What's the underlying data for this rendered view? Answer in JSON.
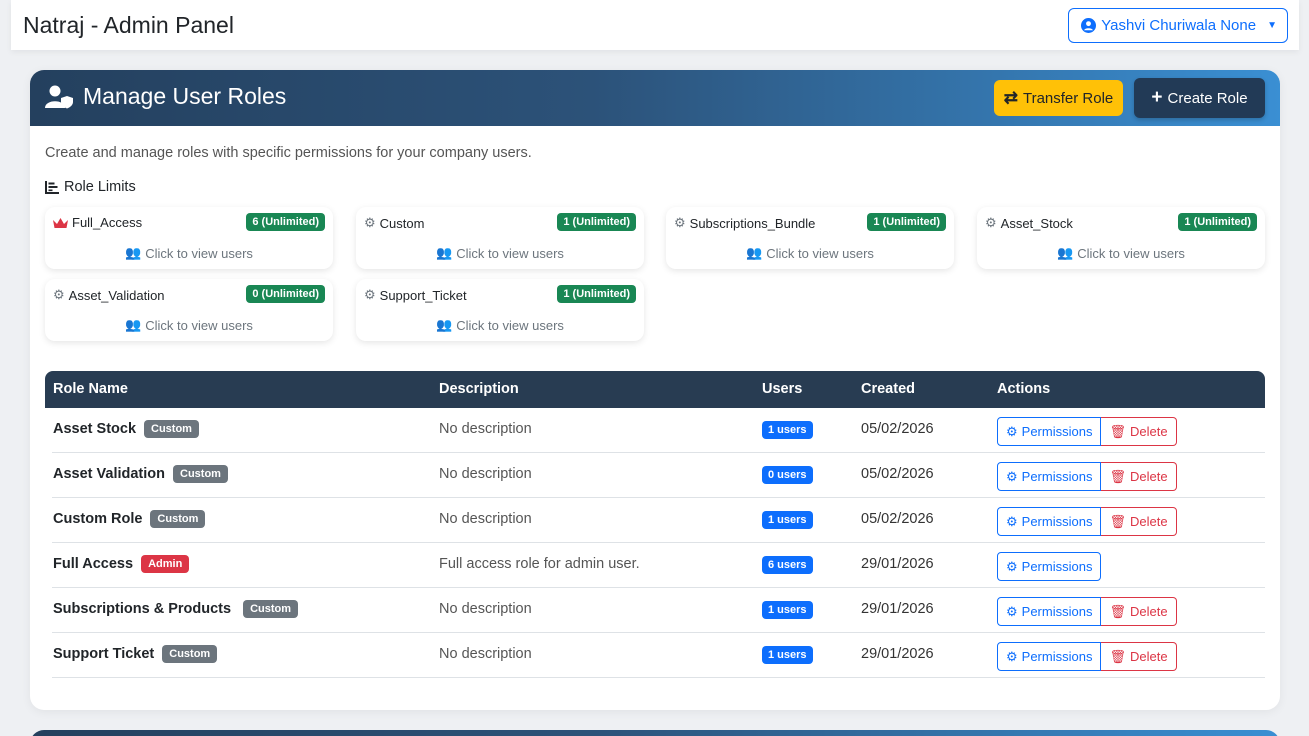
{
  "app": {
    "title": "Natraj - Admin Panel",
    "user_menu": "Yashvi Churiwala None"
  },
  "header": {
    "title": "Manage User Roles",
    "transfer_label": "Transfer Role",
    "create_label": "Create Role"
  },
  "subtitle": "Create and manage roles with specific permissions for your company users.",
  "limits_title": "Role Limits",
  "view_users_label": "Click to view users",
  "role_limits": [
    {
      "name": "Full_Access",
      "badge": "6 (Unlimited)",
      "icon": "crown-icon"
    },
    {
      "name": "Custom",
      "badge": "1 (Unlimited)",
      "icon": "gears-icon"
    },
    {
      "name": "Subscriptions_Bundle",
      "badge": "1 (Unlimited)",
      "icon": "gears-icon"
    },
    {
      "name": "Asset_Stock",
      "badge": "1 (Unlimited)",
      "icon": "gears-icon"
    },
    {
      "name": "Asset_Validation",
      "badge": "0 (Unlimited)",
      "icon": "gears-icon"
    },
    {
      "name": "Support_Ticket",
      "badge": "1 (Unlimited)",
      "icon": "gears-icon"
    }
  ],
  "table": {
    "headers": [
      "Role Name",
      "Description",
      "Users",
      "Created",
      "Actions"
    ],
    "permissions_label": "Permissions",
    "delete_label": "Delete",
    "rows": [
      {
        "name": "Asset Stock",
        "type": "Custom",
        "description": "No description",
        "users": "1 users",
        "created": "05/02/2026"
      },
      {
        "name": "Asset Validation",
        "type": "Custom",
        "description": "No description",
        "users": "0 users",
        "created": "05/02/2026"
      },
      {
        "name": "Custom Role",
        "type": "Custom",
        "description": "No description",
        "users": "1 users",
        "created": "05/02/2026"
      },
      {
        "name": "Full Access",
        "type": "Admin",
        "description": "Full access role for admin user.",
        "users": "6 users",
        "created": "29/01/2026"
      },
      {
        "name": "Subscriptions & Products",
        "type": "Custom",
        "description": "No description",
        "users": "1 users",
        "created": "29/01/2026"
      },
      {
        "name": "Support Ticket",
        "type": "Custom",
        "description": "No description",
        "users": "1 users",
        "created": "29/01/2026"
      }
    ]
  },
  "colors": {
    "primary": "#0d6efd",
    "danger": "#dc3545",
    "warning": "#ffc107",
    "success": "#198754",
    "secondary": "#6c757d",
    "table_header": "#283c52"
  }
}
